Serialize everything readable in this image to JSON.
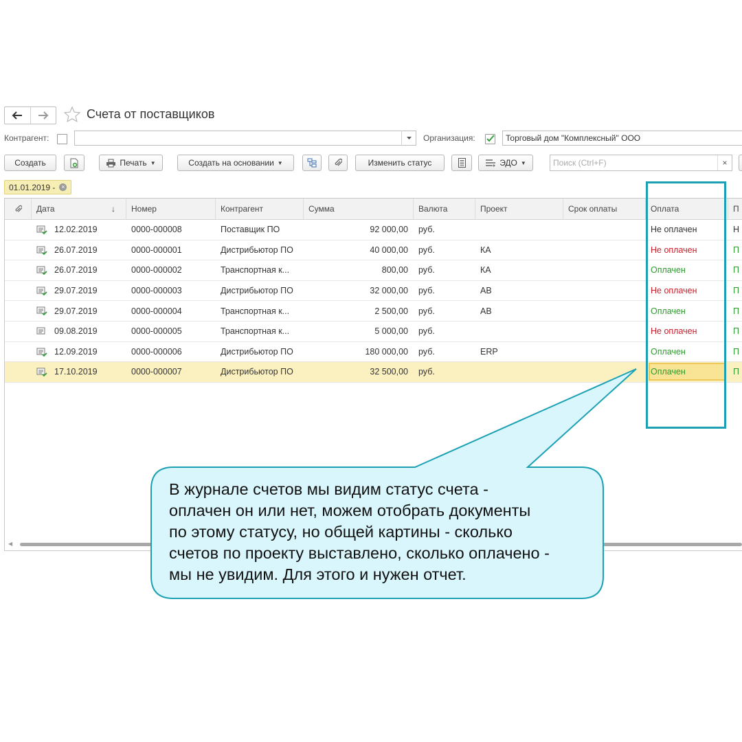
{
  "window": {
    "title": "Счета от поставщиков"
  },
  "filters": {
    "counterparty_label": "Контрагент:",
    "counterparty_value": "",
    "organization_label": "Организация:",
    "organization_value": "Торговый дом \"Комплексный\" ООО"
  },
  "toolbar": {
    "create": "Создать",
    "print": "Печать",
    "create_based_on": "Создать на основании",
    "change_status": "Изменить статус",
    "edo": "ЭДО",
    "search_placeholder": "Поиск (Ctrl+F)",
    "search_clear": "×"
  },
  "period_filter": {
    "label": "01.01.2019 -",
    "clear": "×"
  },
  "table": {
    "columns": [
      "Дата",
      "Номер",
      "Контрагент",
      "Сумма",
      "Валюта",
      "Проект",
      "Срок оплаты",
      "Оплата",
      "П"
    ],
    "sort_indicator": "↓",
    "rows": [
      {
        "date": "12.02.2019",
        "number": "0000-000008",
        "counterparty": "Поставщик ПО",
        "sum": "92 000,00",
        "currency": "руб.",
        "project": "",
        "due": "",
        "payment": "Не оплачен",
        "status": "black",
        "extra": "Н"
      },
      {
        "date": "26.07.2019",
        "number": "0000-000001",
        "counterparty": "Дистрибьютор ПО",
        "sum": "40 000,00",
        "currency": "руб.",
        "project": "КА",
        "due": "",
        "payment": "Не оплачен",
        "status": "red",
        "extra": "П"
      },
      {
        "date": "26.07.2019",
        "number": "0000-000002",
        "counterparty": "Транспортная к...",
        "sum": "800,00",
        "currency": "руб.",
        "project": "КА",
        "due": "",
        "payment": "Оплачен",
        "status": "green",
        "extra": "П"
      },
      {
        "date": "29.07.2019",
        "number": "0000-000003",
        "counterparty": "Дистрибьютор ПО",
        "sum": "32 000,00",
        "currency": "руб.",
        "project": "АВ",
        "due": "",
        "payment": "Не оплачен",
        "status": "red",
        "extra": "П"
      },
      {
        "date": "29.07.2019",
        "number": "0000-000004",
        "counterparty": "Транспортная к...",
        "sum": "2 500,00",
        "currency": "руб.",
        "project": "АВ",
        "due": "",
        "payment": "Оплачен",
        "status": "green",
        "extra": "П"
      },
      {
        "date": "09.08.2019",
        "number": "0000-000005",
        "counterparty": "Транспортная к...",
        "sum": "5 000,00",
        "currency": "руб.",
        "project": "",
        "due": "",
        "payment": "Не оплачен",
        "status": "red",
        "extra": "П"
      },
      {
        "date": "12.09.2019",
        "number": "0000-000006",
        "counterparty": "Дистрибьютор ПО",
        "sum": "180 000,00",
        "currency": "руб.",
        "project": "ERP",
        "due": "",
        "payment": "Оплачен",
        "status": "green",
        "extra": "П"
      },
      {
        "date": "17.10.2019",
        "number": "0000-000007",
        "counterparty": "Дистрибьютор ПО",
        "sum": "32 500,00",
        "currency": "руб.",
        "project": "",
        "due": "",
        "payment": "Оплачен",
        "status": "green",
        "extra": "П",
        "selected": true
      }
    ]
  },
  "callout": {
    "lines": [
      "В журнале счетов мы видим статус счета -",
      "оплачен он или нет, можем отобрать документы",
      "по этому статусу, но общей картины - сколько",
      "счетов по проекту выставлено, сколько оплачено -",
      "мы не увидим. Для этого и нужен отчет."
    ]
  },
  "colors": {
    "accent_teal": "#1ba0b4",
    "callout_fill": "#d9f6fc",
    "status_red": "#c8202c",
    "status_green": "#2e9a2e",
    "selected_row": "#fbf0c0",
    "check_green": "#3aa040"
  },
  "icons": [
    "back-arrow-icon",
    "forward-arrow-icon",
    "star-icon",
    "checkbox-icon",
    "checkmark-icon",
    "dropdown-arrow-icon",
    "copy-document-icon",
    "printer-icon",
    "structure-icon",
    "paperclip-icon",
    "list-icon",
    "edo-icon",
    "document-posted-icon",
    "clear-icon"
  ]
}
